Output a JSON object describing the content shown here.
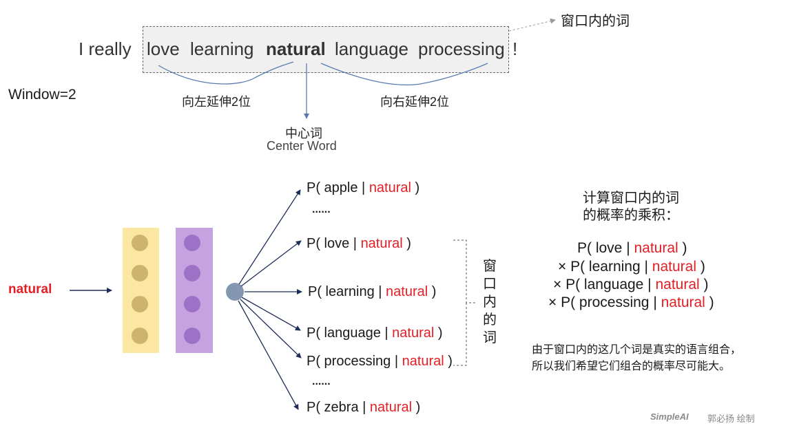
{
  "sentence": {
    "before": "I really",
    "w1": "love",
    "w2": "learning",
    "center": "natural",
    "w4": "language",
    "w5": "processing",
    "after": "!"
  },
  "window_label": "Window=2",
  "window_callout": "窗口内的词",
  "extend_left": "向左延伸2位",
  "extend_right": "向右延伸2位",
  "center_word": {
    "cn": "中心词",
    "en": "Center Word"
  },
  "input_word": "natural",
  "probabilities": [
    {
      "pre": "P( apple | ",
      "cond": "natural",
      "post": " )"
    },
    {
      "pre": "......"
    },
    {
      "pre": "P( love | ",
      "cond": "natural",
      "post": " )"
    },
    {
      "pre": "P( learning | ",
      "cond": "natural",
      "post": " )"
    },
    {
      "pre": "P( language | ",
      "cond": "natural",
      "post": " )"
    },
    {
      "pre": "P( processing | ",
      "cond": "natural",
      "post": " )"
    },
    {
      "pre": "......"
    },
    {
      "pre": "P( zebra | ",
      "cond": "natural",
      "post": " )"
    }
  ],
  "window_bracket_label": [
    "窗",
    "口",
    "内",
    "的",
    "词"
  ],
  "product": {
    "heading1": "计算窗口内的词",
    "heading2": "的概率的乘积：",
    "lines": [
      {
        "pre": "P( love | ",
        "cond": "natural",
        "post": " )"
      },
      {
        "pre": "× P( learning | ",
        "cond": "natural",
        "post": " )"
      },
      {
        "pre": "× P( language | ",
        "cond": "natural",
        "post": " )"
      },
      {
        "pre": "× P( processing | ",
        "cond": "natural",
        "post": " )"
      }
    ],
    "note1": "由于窗口内的这几个词是真实的语言组合，",
    "note2": "所以我们希望它们组合的概率尽可能大。"
  },
  "footer": {
    "brand": "SimpleAI",
    "author": "郭必扬 绘制"
  },
  "colors": {
    "highlight": "#e31e24",
    "window_fill": "#f0f0f0",
    "yellow_layer": "#fbe6a2",
    "yellow_dot": "#cdb46c",
    "purple_layer": "#c6a3e0",
    "purple_dot": "#9d71c6",
    "output_node": "#8497b0",
    "arrow": "#1f2d5a"
  }
}
